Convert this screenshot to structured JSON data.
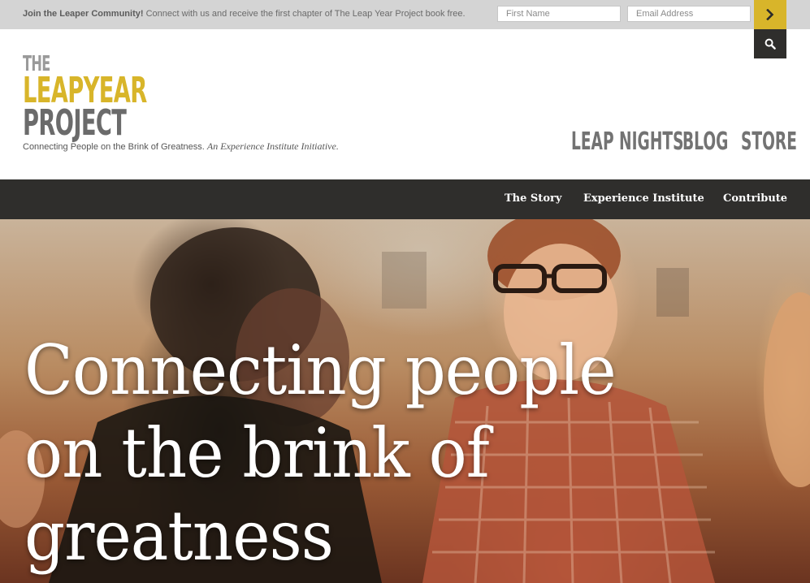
{
  "signup": {
    "promo_bold": "Join the Leaper Community!",
    "promo_text": "Connect with us and receive the first chapter of The Leap Year Project book free.",
    "first_name_placeholder": "First Name",
    "email_placeholder": "Email Address",
    "submit_icon": "chevron-right-icon",
    "search_icon": "search-icon"
  },
  "logo": {
    "line1": "THE",
    "line2": "LEAPYEAR",
    "line3": "PROJECT"
  },
  "tagline": {
    "text": "Connecting People on the Brink of Greatness.",
    "italic": "An Experience Institute Initiative."
  },
  "main_nav": [
    "LEAP NIGHTS",
    "BLOG",
    "STORE"
  ],
  "sub_nav": [
    "The Story",
    "Experience Institute",
    "Contribute"
  ],
  "hero": {
    "lines": [
      "Connecting people",
      "on the brink of",
      "greatness"
    ]
  },
  "colors": {
    "accent": "#d8b52a",
    "dark": "#2f2e2c",
    "topbar": "#d4d4d4",
    "nav_gray": "#737373"
  }
}
